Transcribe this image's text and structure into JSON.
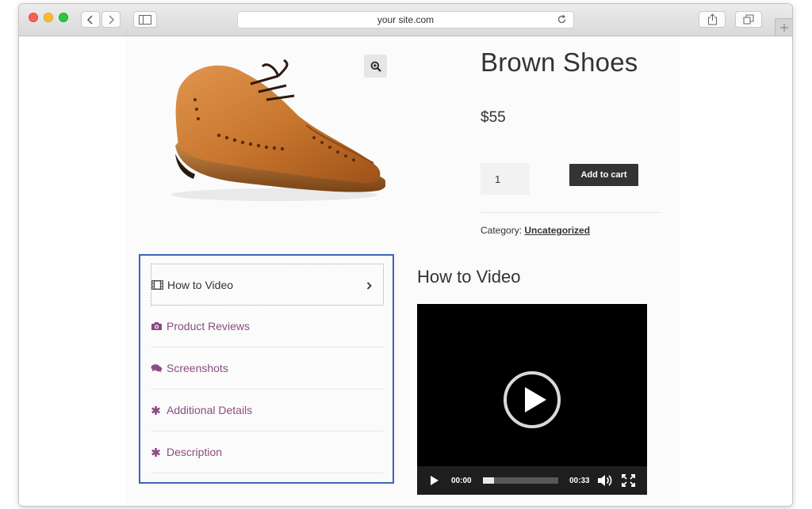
{
  "browser": {
    "url": "your site.com"
  },
  "product": {
    "title": "Brown Shoes",
    "price": "$55",
    "quantity": "1",
    "add_to_cart_label": "Add to cart",
    "category_label": "Category:",
    "category_value": "Uncategorized"
  },
  "tabs": [
    {
      "label": "How to Video",
      "icon": "film-icon",
      "active": true
    },
    {
      "label": "Product Reviews",
      "icon": "camera-icon",
      "active": false
    },
    {
      "label": "Screenshots",
      "icon": "comments-icon",
      "active": false
    },
    {
      "label": "Additional Details",
      "icon": "asterisk-icon",
      "active": false
    },
    {
      "label": "Description",
      "icon": "asterisk-icon",
      "active": false
    }
  ],
  "video": {
    "heading": "How to Video",
    "current_time": "00:00",
    "duration": "00:33",
    "progress_fraction": 0.15
  },
  "colors": {
    "tab_link": "#8a4c82",
    "tabs_border": "#3d64b8",
    "button_bg": "#333333"
  }
}
